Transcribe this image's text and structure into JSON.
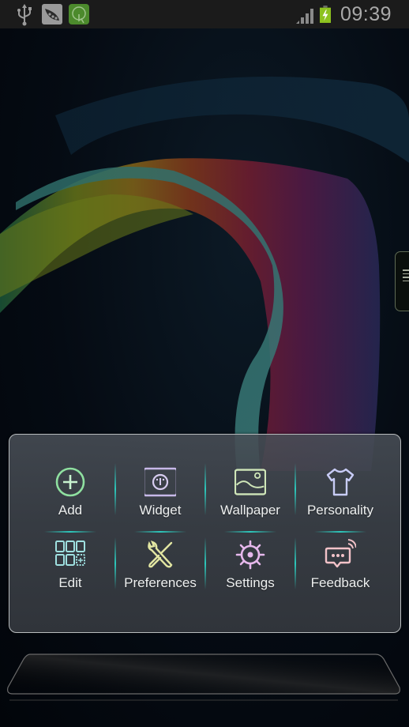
{
  "status_bar": {
    "left_icons": [
      "usb-icon",
      "pea-app-icon",
      "touch-app-icon"
    ],
    "right_icons": [
      "signal-icon",
      "battery-charging-icon"
    ],
    "time": "09:39",
    "colors": {
      "background": "#1b1b1b",
      "battery": "#8dc21f",
      "text": "#a9a9a9"
    }
  },
  "wallpaper": {
    "description": "rainbow ribbon abstract"
  },
  "side_handle": {
    "icon": "drawer-handle-icon"
  },
  "menu": {
    "items": [
      {
        "label": "Add",
        "icon": "add-circle-icon",
        "color": "#8fe0a0"
      },
      {
        "label": "Widget",
        "icon": "widget-icon",
        "color": "#c7b8e8"
      },
      {
        "label": "Wallpaper",
        "icon": "wallpaper-icon",
        "color": "#cfe6b8"
      },
      {
        "label": "Personality",
        "icon": "tshirt-icon",
        "color": "#c8ccf6"
      },
      {
        "label": "Edit",
        "icon": "edit-grid-icon",
        "color": "#9fe0e0"
      },
      {
        "label": "Preferences",
        "icon": "tools-icon",
        "color": "#e2e6a2"
      },
      {
        "label": "Settings",
        "icon": "settings-gear-icon",
        "color": "#e6b8ec"
      },
      {
        "label": "Feedback",
        "icon": "feedback-icon",
        "color": "#f2c2c8"
      }
    ],
    "accent_color": "#2cd6c8"
  },
  "dock": {
    "icon": "dock-tray"
  }
}
